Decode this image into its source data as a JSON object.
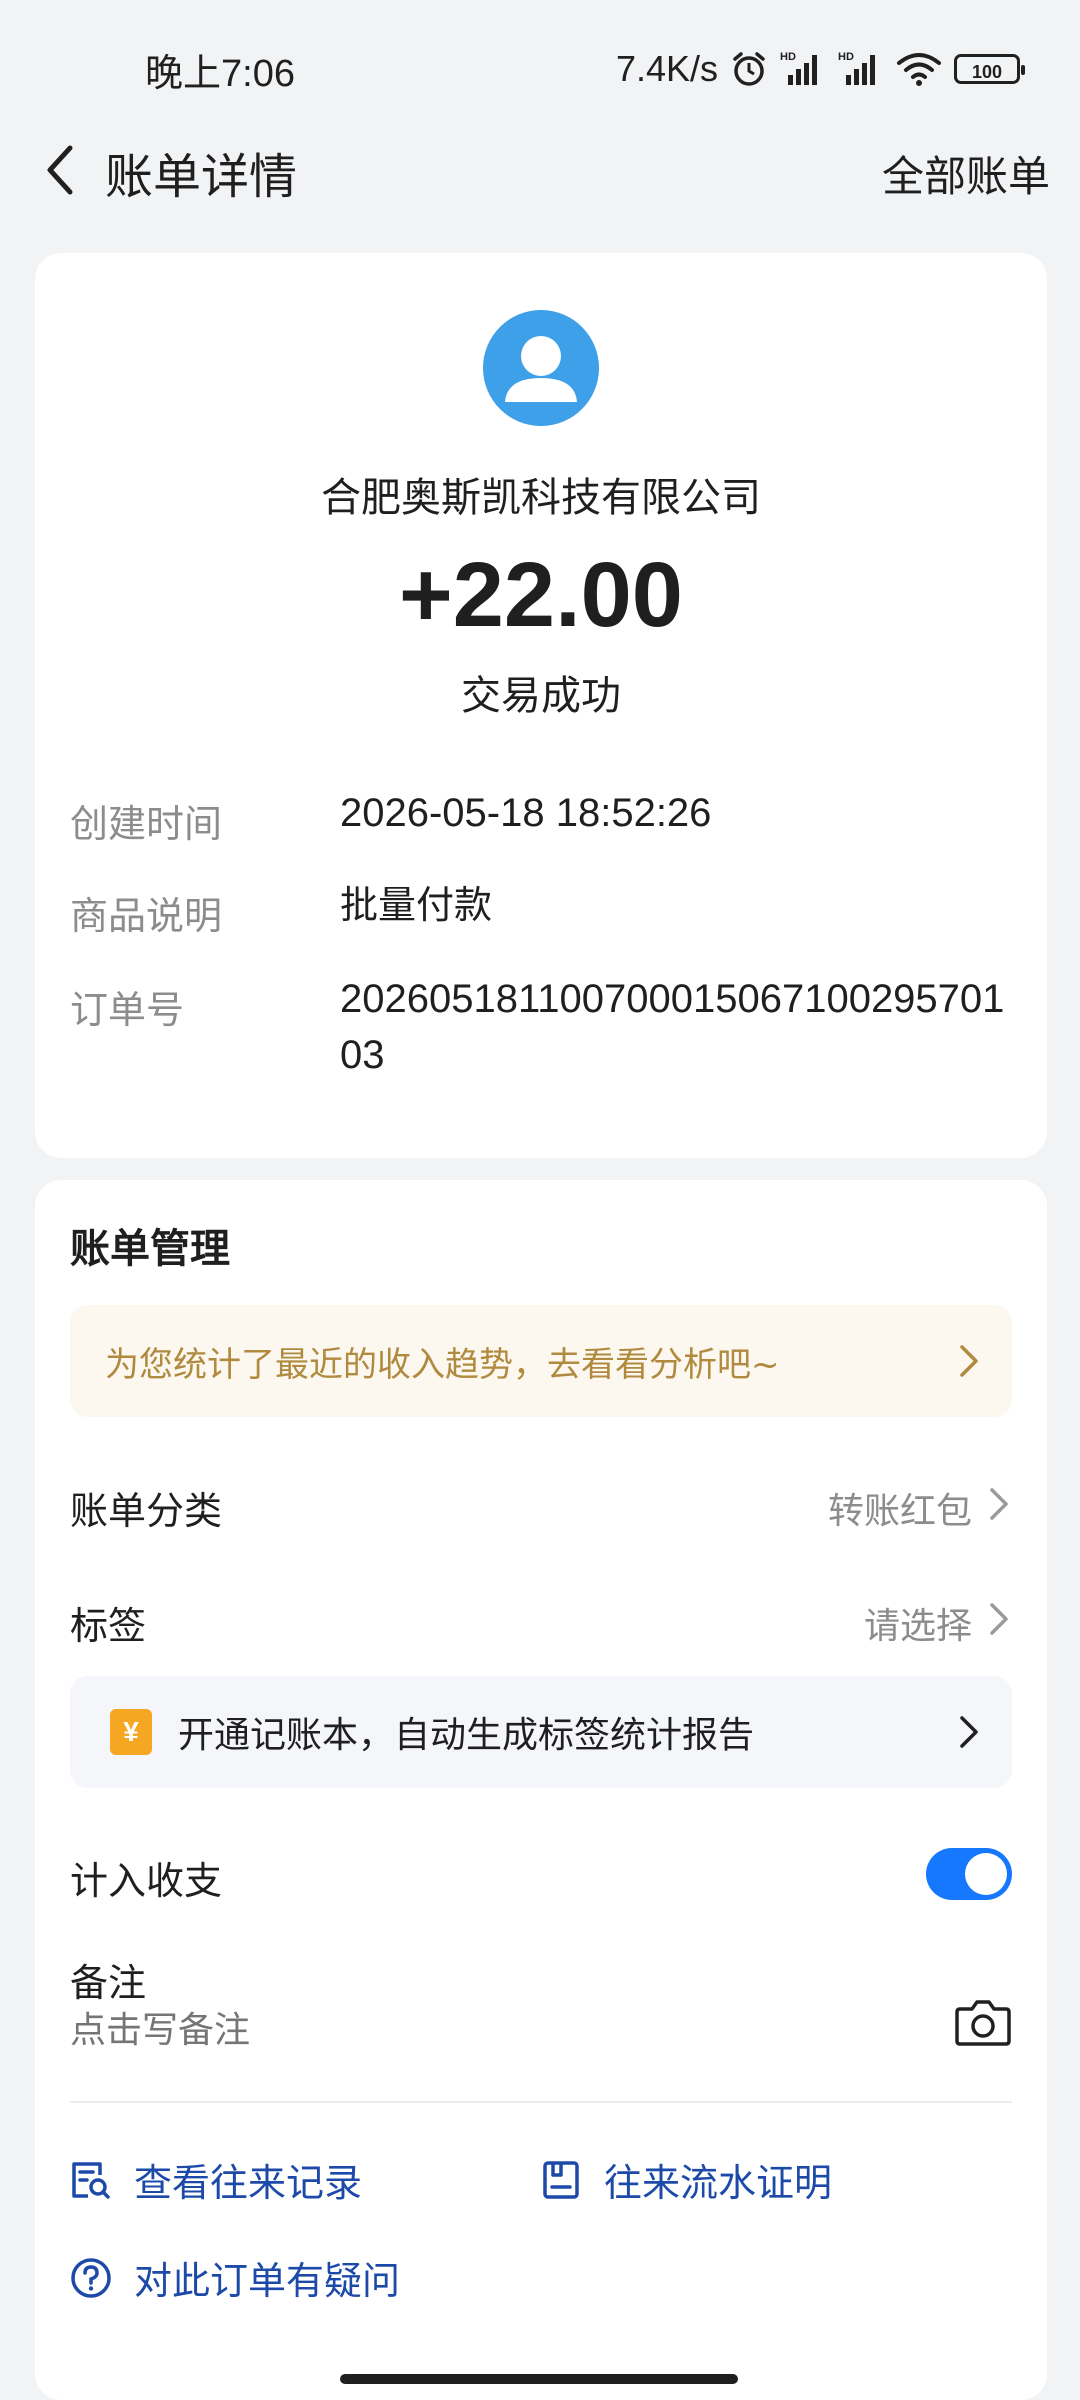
{
  "status_bar": {
    "time": "晚上7:06",
    "network_speed": "7.4K/s",
    "battery": "100"
  },
  "header": {
    "title": "账单详情",
    "right_link": "全部账单"
  },
  "transaction": {
    "merchant": "合肥奥斯凯科技有限公司",
    "amount": "+22.00",
    "status": "交易成功",
    "details": [
      {
        "label": "创建时间",
        "value": "2026-05-18 18:52:26"
      },
      {
        "label": "商品说明",
        "value": "批量付款"
      },
      {
        "label": "订单号",
        "value": "20260518110070001506710029570103"
      }
    ]
  },
  "management": {
    "title": "账单管理",
    "promo": "为您统计了最近的收入趋势，去看看分析吧~",
    "category_label": "账单分类",
    "category_value": "转账红包",
    "tag_label": "标签",
    "tag_value": "请选择",
    "ledger_icon": "¥",
    "ledger_text": "开通记账本，自动生成标签统计报告",
    "include_label": "计入收支",
    "include_enabled": true,
    "remark_label": "备注",
    "remark_placeholder": "点击写备注",
    "links": {
      "records": "查看往来记录",
      "proof": "往来流水证明",
      "question": "对此订单有疑问"
    }
  },
  "colors": {
    "accent_blue": "#1677ff",
    "link_blue": "#1d4aa8",
    "avatar_blue": "#3fa0ea",
    "promo_gold": "#b08a3e",
    "ledger_orange": "#f5a623"
  }
}
